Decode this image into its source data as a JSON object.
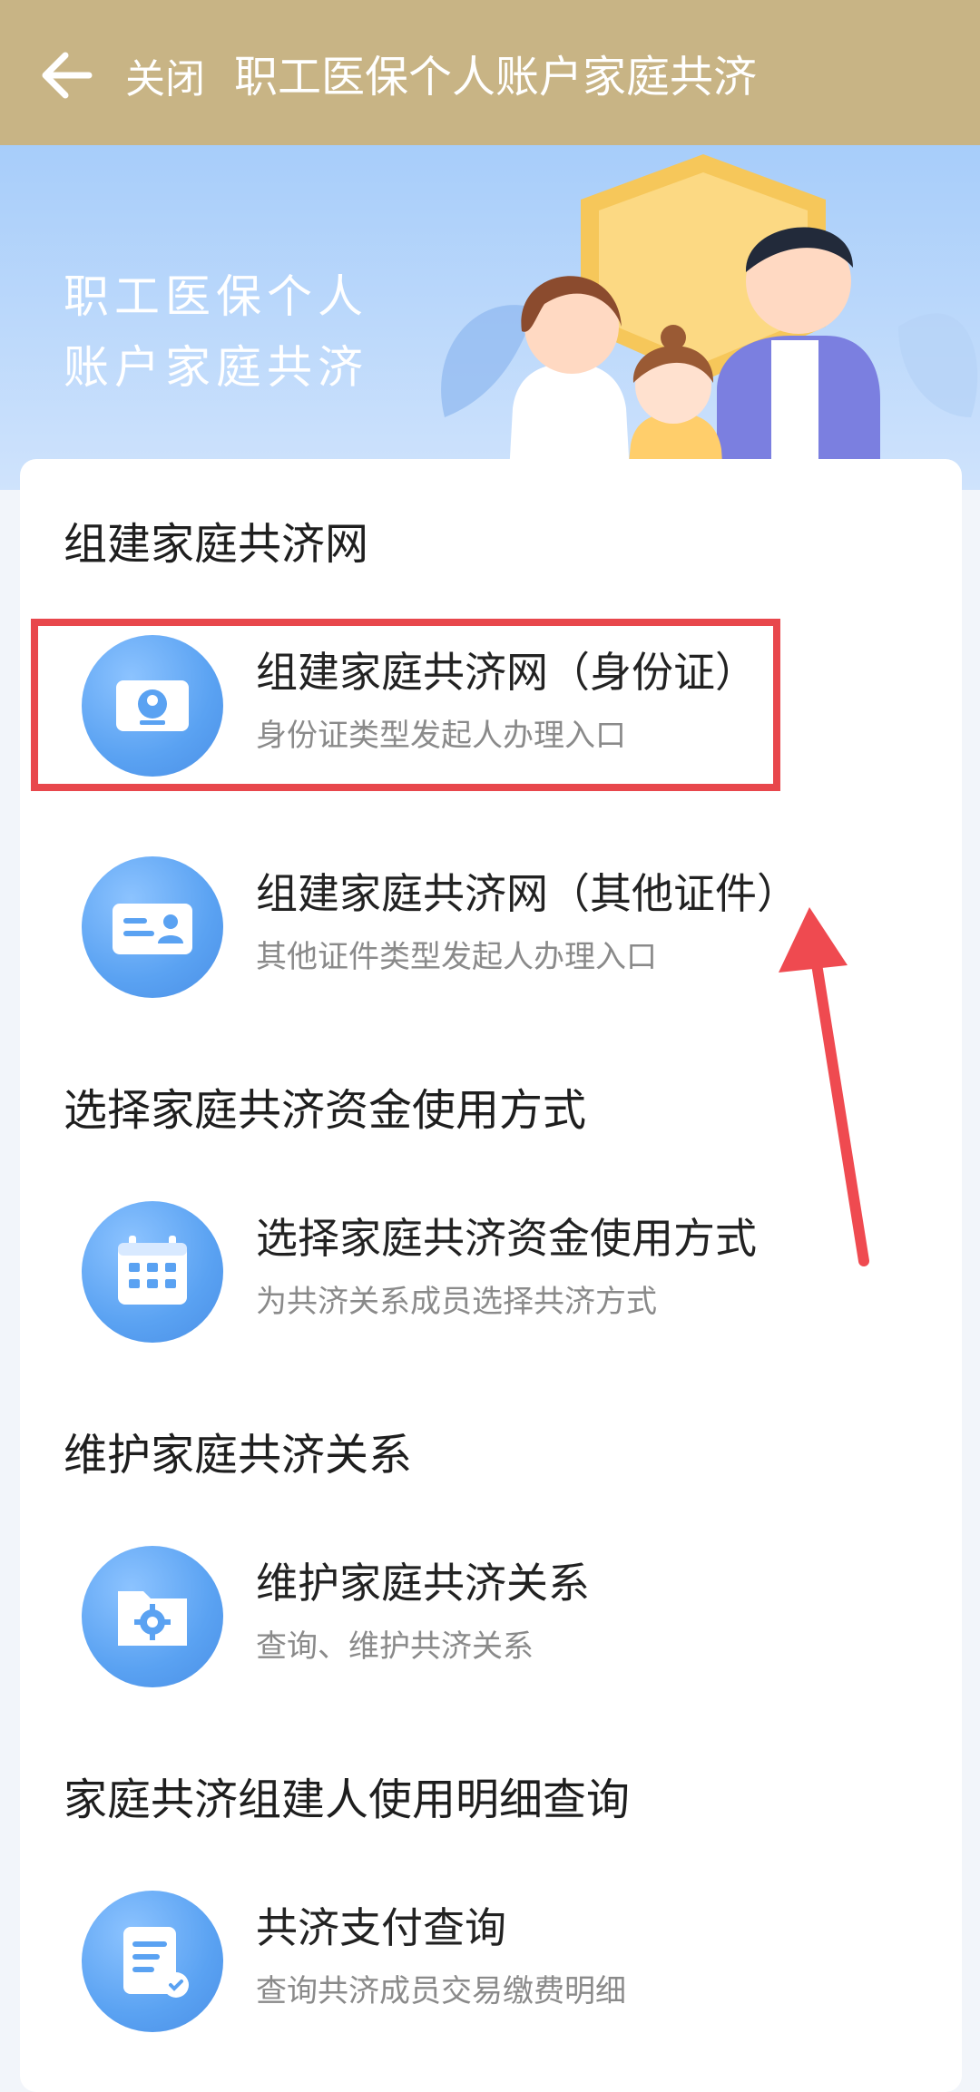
{
  "nav": {
    "title": "职工医保个人账户家庭共济",
    "close_label": "关闭",
    "back_icon": "back-arrow-icon"
  },
  "banner": {
    "line1": "职工医保个人",
    "line2": "账户家庭共济"
  },
  "sections": [
    {
      "title": "组建家庭共济网",
      "items": [
        {
          "title": "组建家庭共济网（身份证）",
          "subtitle": "身份证类型发起人办理入口",
          "icon": "id-card-icon"
        },
        {
          "title": "组建家庭共济网（其他证件）",
          "subtitle": "其他证件类型发起人办理入口",
          "icon": "certificate-icon"
        }
      ]
    },
    {
      "title": "选择家庭共济资金使用方式",
      "items": [
        {
          "title": "选择家庭共济资金使用方式",
          "subtitle": "为共济关系成员选择共济方式",
          "icon": "calendar-icon"
        }
      ]
    },
    {
      "title": "维护家庭共济关系",
      "items": [
        {
          "title": "维护家庭共济关系",
          "subtitle": "查询、维护共济关系",
          "icon": "folder-gear-icon"
        }
      ]
    },
    {
      "title": "家庭共济组建人使用明细查询",
      "items": [
        {
          "title": "共济支付查询",
          "subtitle": "查询共济成员交易缴费明细",
          "icon": "document-icon"
        }
      ]
    }
  ],
  "colors": {
    "nav_bg": "#c8b485",
    "banner_bg": "#a7cdfa",
    "icon_blue": "#5aa2f2",
    "highlight_red": "#e8474c"
  }
}
